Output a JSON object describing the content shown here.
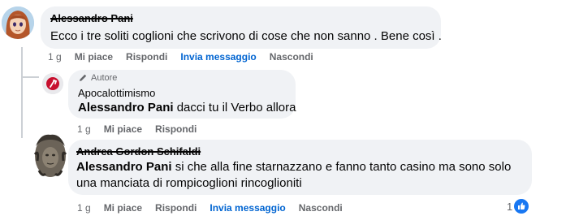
{
  "comments": [
    {
      "author": "Alessandro Pani",
      "text": "Ecco i tre soliti coglioni che scrivono di cose che non sanno . Bene così .",
      "actions": {
        "time": "1 g",
        "like": "Mi piace",
        "reply": "Rispondi",
        "message": "Invia messaggio",
        "hide": "Nascondi"
      }
    },
    {
      "badge": "Autore",
      "author": "Apocalottimismo",
      "mention": "Alessandro Pani",
      "text": " dacci tu il Verbo allora",
      "actions": {
        "time": "1 g",
        "like": "Mi piace",
        "reply": "Rispondi"
      }
    },
    {
      "author": "Andrea Gordon Schifaldi",
      "mention": "Alessandro Pani",
      "text_line1": " si che alla fine starnazzano e fanno tanto casino ma sono solo",
      "text_line2": "una manciata di rompicoglioni rincoglioniti",
      "actions": {
        "time": "1 g",
        "like": "Mi piace",
        "reply": "Rispondi",
        "message": "Invia messaggio",
        "hide": "Nascondi"
      },
      "reactions": {
        "count": "1",
        "icon": "like-icon"
      }
    }
  ],
  "colors": {
    "bubble": "#f0f2f5",
    "link_blue": "#0064d1",
    "muted": "#65676b",
    "like_blue": "#1877f2"
  }
}
